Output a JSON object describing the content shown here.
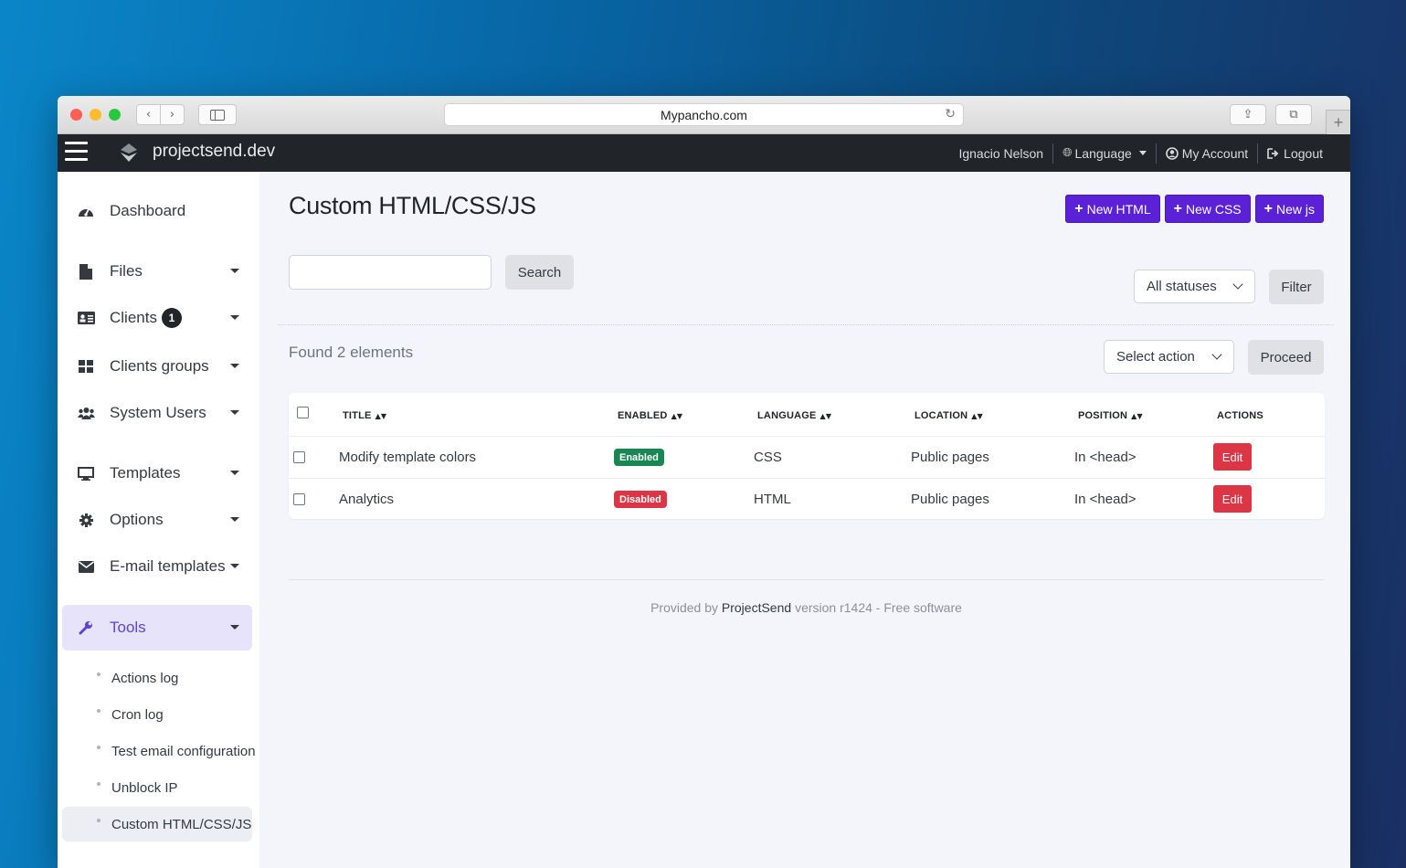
{
  "browser": {
    "url": "Mypancho.com",
    "nav_back": "‹",
    "nav_forward": "›",
    "reload_icon": "↻",
    "share_icon": "⇪",
    "tabs_icon": "⧉",
    "new_tab": "+"
  },
  "topbar": {
    "brand": "projectsend.dev",
    "user_name": "Ignacio Nelson",
    "language": "Language",
    "my_account": "My Account",
    "logout": "Logout"
  },
  "sidebar": {
    "items": [
      {
        "label": "Dashboard",
        "icon": "dashboard-icon"
      },
      {
        "label": "Files",
        "icon": "file-icon"
      },
      {
        "label": "Clients",
        "icon": "id-card-icon",
        "badge": "1"
      },
      {
        "label": "Clients groups",
        "icon": "grid-icon"
      },
      {
        "label": "System Users",
        "icon": "users-icon"
      },
      {
        "label": "Templates",
        "icon": "monitor-icon"
      },
      {
        "label": "Options",
        "icon": "gear-icon"
      },
      {
        "label": "E-mail templates",
        "icon": "envelope-icon"
      },
      {
        "label": "Tools",
        "icon": "wrench-icon"
      }
    ],
    "sub_items": [
      {
        "label": "Actions log"
      },
      {
        "label": "Cron log"
      },
      {
        "label": "Test email configuration"
      },
      {
        "label": "Unblock IP"
      },
      {
        "label": "Custom HTML/CSS/JS"
      }
    ]
  },
  "main": {
    "title": "Custom HTML/CSS/JS",
    "new_html": "New HTML",
    "new_css": "New CSS",
    "new_js": "New js",
    "search_placeholder": "",
    "search_button": "Search",
    "status_select": "All statuses",
    "filter_button": "Filter",
    "found_text": "Found 2 elements",
    "action_select": "Select action",
    "proceed_button": "Proceed"
  },
  "table": {
    "columns": [
      "TITLE",
      "ENABLED",
      "LANGUAGE",
      "LOCATION",
      "POSITION",
      "ACTIONS"
    ],
    "rows": [
      {
        "title": "Modify template colors",
        "enabled": "Enabled",
        "language": "CSS",
        "location": "Public pages",
        "position": "In <head>",
        "action": "Edit"
      },
      {
        "title": "Analytics",
        "enabled": "Disabled",
        "language": "HTML",
        "location": "Public pages",
        "position": "In <head>",
        "action": "Edit"
      }
    ]
  },
  "footer": {
    "prefix": "Provided by",
    "brand": "ProjectSend",
    "suffix": "version r1424 - Free software"
  },
  "colors": {
    "accent": "#5b21d6",
    "topbar": "#212529",
    "enabled": "#198754",
    "disabled": "#dc3545"
  }
}
